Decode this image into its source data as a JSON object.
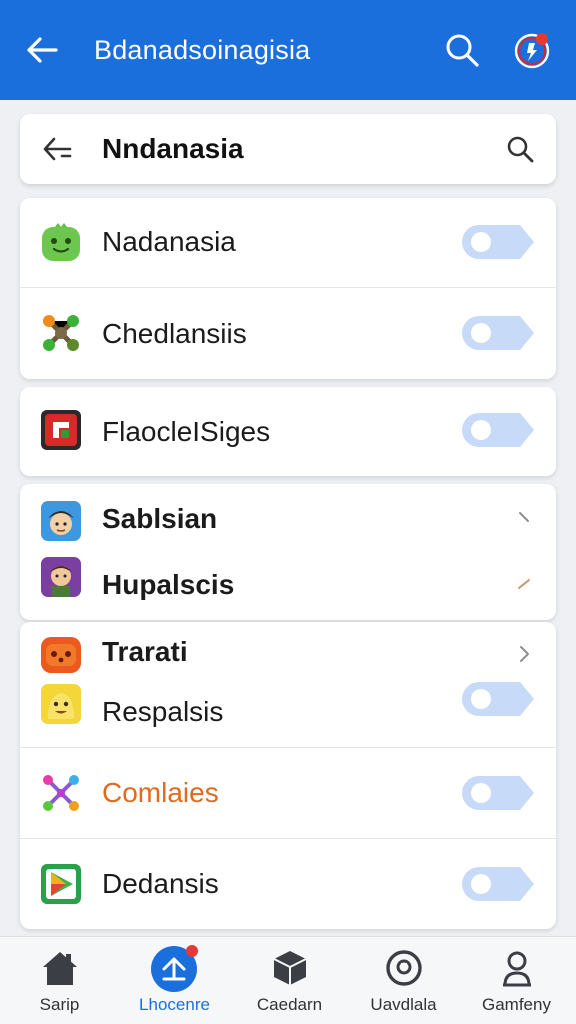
{
  "header": {
    "title": "Bdanadsoinagisia",
    "back_icon": "back-arrow-icon",
    "search_icon": "search-icon",
    "profile_icon": "profile-notification-icon",
    "color": "#1a6fdc"
  },
  "subheader": {
    "title": "Nndanasia",
    "back_icon": "back-arrow-icon",
    "search_icon": "search-icon"
  },
  "items": [
    {
      "label": "Nadanasia",
      "icon": "green-monster-app-icon",
      "control": "toggle",
      "toggle_on": false
    },
    {
      "label": "Chedlansiis",
      "icon": "molecule-app-icon",
      "control": "toggle",
      "toggle_on": false
    },
    {
      "label": "FlaocleISiges",
      "icon": "red-logo-app-icon",
      "control": "toggle",
      "toggle_on": false
    },
    {
      "label": "Sablsian",
      "icon": "boy-avatar-app-icon",
      "control": "chevron"
    },
    {
      "label": "Hupalscis",
      "icon": "man-avatar-app-icon",
      "control": "chevron"
    },
    {
      "label": "Trarati",
      "icon": "orange-game-app-icon",
      "control": "chevron"
    },
    {
      "label": "Respalsis",
      "icon": "yellow-character-app-icon",
      "control": "toggle",
      "toggle_on": false
    },
    {
      "label": "Comlaies",
      "icon": "colorful-molecule-app-icon",
      "control": "toggle",
      "toggle_on": false
    },
    {
      "label": "Dedansis",
      "icon": "play-store-app-icon",
      "control": "toggle",
      "toggle_on": false
    }
  ],
  "bottom_nav": [
    {
      "label": "Sarip",
      "icon": "home-icon",
      "active": false
    },
    {
      "label": "Lhocenre",
      "icon": "upload-badge-icon",
      "active": true
    },
    {
      "label": "Caedarn",
      "icon": "box-icon",
      "active": false
    },
    {
      "label": "Uavdlala",
      "icon": "face-circle-icon",
      "active": false
    },
    {
      "label": "Gamfeny",
      "icon": "person-icon",
      "active": false
    }
  ]
}
